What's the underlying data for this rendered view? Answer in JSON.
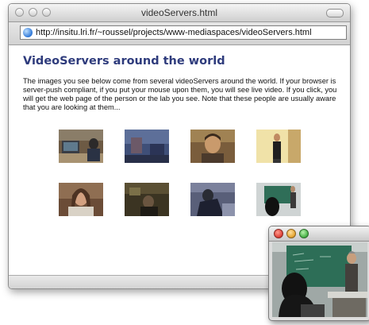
{
  "window": {
    "title": "videoServers.html",
    "url": "http://insitu.lri.fr/~roussel/projects/www-mediaspaces/videoServers.html"
  },
  "page": {
    "heading": "VideoServers around the world",
    "intro": "The images you see below come from several videoServers around the world. If your browser is server-push compliant, if you put your mouse upon them, you will see live video. If you click, you will get the web page of the person or the lab you see. Note that these people are usually aware that you are looking at them..."
  },
  "thumbnails": [
    {
      "name": "video-thumbnail-office-desk"
    },
    {
      "name": "video-thumbnail-blue-room"
    },
    {
      "name": "video-thumbnail-person-face"
    },
    {
      "name": "video-thumbnail-person-standing"
    },
    {
      "name": "video-thumbnail-woman-desk"
    },
    {
      "name": "video-thumbnail-dark-room"
    },
    {
      "name": "video-thumbnail-person-leaning"
    },
    {
      "name": "video-thumbnail-classroom"
    }
  ],
  "icons": [
    "globe-icon",
    "close-button",
    "minimize-button",
    "zoom-button",
    "toolbar-toggle-button"
  ],
  "colors": {
    "heading": "#2e3b7c",
    "close": "#e0443a",
    "minimize": "#e7a733",
    "zoom": "#4bb34a",
    "chalkboard": "#2f6e58"
  }
}
